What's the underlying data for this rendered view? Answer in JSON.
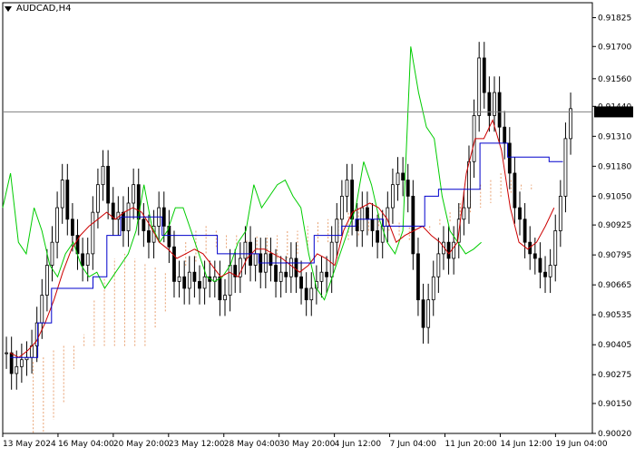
{
  "chart_title": "AUDCAD,H4",
  "current_price": "0.91416",
  "colors": {
    "candles": "#000000",
    "tenkan": "#cc0000",
    "kijun": "#0000cc",
    "chikou": "#00cc00",
    "cloud": "#e8a070",
    "price_line": "#808080",
    "price_box": "#000000"
  },
  "chart_data": {
    "type": "line",
    "title": "AUDCAD,H4",
    "xlabel": "",
    "ylabel": "",
    "ylim": [
      0.9002,
      0.9189
    ],
    "y_ticks": [
      "0.91825",
      "0.91700",
      "0.91560",
      "0.91440",
      "0.91310",
      "0.91180",
      "0.91050",
      "0.90925",
      "0.90795",
      "0.90665",
      "0.90535",
      "0.90405",
      "0.90275",
      "0.90150",
      "0.90020"
    ],
    "x_ticks": [
      "13 May 2024",
      "16 May 04:00",
      "20 May 20:00",
      "23 May 12:00",
      "28 May 04:00",
      "30 May 20:00",
      "4 Jun 12:00",
      "7 Jun 04:00",
      "11 Jun 20:00",
      "14 Jun 12:00",
      "19 Jun 04:00"
    ],
    "grid": false,
    "x_range": [
      0,
      160
    ],
    "x_ticks_at": [
      0,
      15,
      30,
      45,
      60,
      75,
      90,
      105,
      120,
      135,
      150
    ],
    "candle_closes": [
      0.9037,
      0.9028,
      0.9031,
      0.9034,
      0.9035,
      0.904,
      0.905,
      0.9062,
      0.9075,
      0.9085,
      0.91,
      0.9112,
      0.9095,
      0.9088,
      0.908,
      0.9075,
      0.908,
      0.9098,
      0.911,
      0.9118,
      0.9102,
      0.9095,
      0.9098,
      0.909,
      0.9102,
      0.911,
      0.9095,
      0.909,
      0.9085,
      0.9092,
      0.91,
      0.9092,
      0.9083,
      0.9068,
      0.907,
      0.9065,
      0.9072,
      0.9068,
      0.9065,
      0.907,
      0.9068,
      0.907,
      0.906,
      0.9062,
      0.9075,
      0.907,
      0.9078,
      0.9085,
      0.9075,
      0.908,
      0.9072,
      0.908,
      0.9075,
      0.9068,
      0.9072,
      0.907,
      0.9078,
      0.907,
      0.9065,
      0.906,
      0.9065,
      0.9068,
      0.9072,
      0.907,
      0.9085,
      0.9095,
      0.9105,
      0.9112,
      0.9095,
      0.909,
      0.91,
      0.9095,
      0.909,
      0.9085,
      0.9092,
      0.91,
      0.911,
      0.9115,
      0.9112,
      0.9105,
      0.908,
      0.906,
      0.9048,
      0.906,
      0.907,
      0.908,
      0.9085,
      0.9078,
      0.9085,
      0.9095,
      0.91,
      0.912,
      0.914,
      0.9165,
      0.915,
      0.914,
      0.915,
      0.9135,
      0.9128,
      0.9115,
      0.91,
      0.9095,
      0.9085,
      0.908,
      0.9078,
      0.9072,
      0.907,
      0.9075,
      0.909,
      0.9105,
      0.913,
      0.9143
    ],
    "series": [
      {
        "name": "",
        "values": [
          0.9037,
          0.9035,
          0.9038,
          0.9042,
          0.905,
          0.906,
          0.9072,
          0.9082,
          0.9088,
          0.9092,
          0.9095,
          0.9098,
          0.9095,
          0.9098,
          0.91,
          0.9098,
          0.9092,
          0.9085,
          0.9082,
          0.9078,
          0.908,
          0.9082,
          0.908,
          0.9075,
          0.907,
          0.9072,
          0.907,
          0.9078,
          0.9082,
          0.9082,
          0.908,
          0.9078,
          0.9075,
          0.9072,
          0.9075,
          0.908,
          0.9078,
          0.9075,
          0.909,
          0.9098,
          0.91,
          0.9102,
          0.91,
          0.9095,
          0.9085,
          0.9088,
          0.909,
          0.9092,
          0.9088,
          0.9085,
          0.908,
          0.9085,
          0.9115,
          0.913,
          0.913,
          0.9138,
          0.9125,
          0.91,
          0.9085,
          0.9082,
          0.9085,
          0.9092,
          0.91
        ]
      },
      {
        "name": "",
        "values": [
          0.9035,
          0.9035,
          0.905,
          0.9065,
          0.9065,
          0.9065,
          0.907,
          0.9088,
          0.9096,
          0.9096,
          0.9096,
          0.9088,
          0.9088,
          0.9088,
          0.9088,
          0.908,
          0.908,
          0.908,
          0.9076,
          0.9076,
          0.9076,
          0.9076,
          0.9088,
          0.9088,
          0.9092,
          0.9095,
          0.9095,
          0.9092,
          0.9092,
          0.9092,
          0.9105,
          0.9108,
          0.9108,
          0.9108,
          0.9128,
          0.9128,
          0.9122,
          0.9122,
          0.9122,
          0.912
        ]
      },
      {
        "name": "",
        "values": [
          0.91,
          0.9115,
          0.9085,
          0.908,
          0.91,
          0.909,
          0.9075,
          0.907,
          0.908,
          0.9085,
          0.9075,
          0.907,
          0.9072,
          0.9065,
          0.907,
          0.9075,
          0.908,
          0.909,
          0.911,
          0.9092,
          0.9085,
          0.909,
          0.91,
          0.91,
          0.909,
          0.908,
          0.907,
          0.9068,
          0.907,
          0.9075,
          0.9085,
          0.909,
          0.911,
          0.91,
          0.9105,
          0.911,
          0.9112,
          0.9105,
          0.91,
          0.908,
          0.9065,
          0.906,
          0.907,
          0.908,
          0.909,
          0.91,
          0.912,
          0.911,
          0.9095,
          0.9085,
          0.908,
          0.909,
          0.917,
          0.915,
          0.9135,
          0.913,
          0.9105,
          0.909,
          0.9085,
          0.908,
          0.9082,
          0.9085
        ]
      },
      {
        "name": "",
        "values": [
          0.9033,
          0.9035,
          0.9038,
          0.904,
          0.904,
          0.904,
          0.904,
          0.904,
          0.904,
          0.904,
          0.904,
          0.904,
          0.9048,
          0.9055,
          0.907,
          0.9085,
          0.909,
          0.9092,
          0.909,
          0.9088,
          0.9088,
          0.9085,
          0.9082,
          0.908,
          0.9078,
          0.9078,
          0.908,
          0.9082,
          0.9085,
          0.9085,
          0.9085,
          0.9086,
          0.9088,
          0.909,
          0.9092,
          0.909,
          0.9088,
          0.9086,
          0.909,
          0.9092,
          0.9095,
          0.9098,
          0.9102,
          0.9105,
          0.911,
          0.9112,
          0.9115,
          0.9112,
          0.911,
          0.9108
        ]
      },
      {
        "name": "",
        "values": [
          0.9002,
          0.9002,
          0.9008,
          0.9015,
          0.903,
          0.9045,
          0.906,
          0.907,
          0.9078,
          0.908,
          0.9078,
          0.9076,
          0.9074,
          0.9072,
          0.9072,
          0.9074,
          0.9076,
          0.908,
          0.9082,
          0.9082,
          0.9084,
          0.9086,
          0.9088,
          0.9088,
          0.9088,
          0.909,
          0.909,
          0.9092,
          0.9094,
          0.9095,
          0.9096,
          0.9098,
          0.91,
          0.91,
          0.9098,
          0.9096,
          0.9094,
          0.9092,
          0.909,
          0.909,
          0.9092,
          0.9094,
          0.9096,
          0.9098,
          0.91,
          0.9102,
          0.9104,
          0.9106,
          0.9108,
          0.911
        ]
      }
    ]
  }
}
